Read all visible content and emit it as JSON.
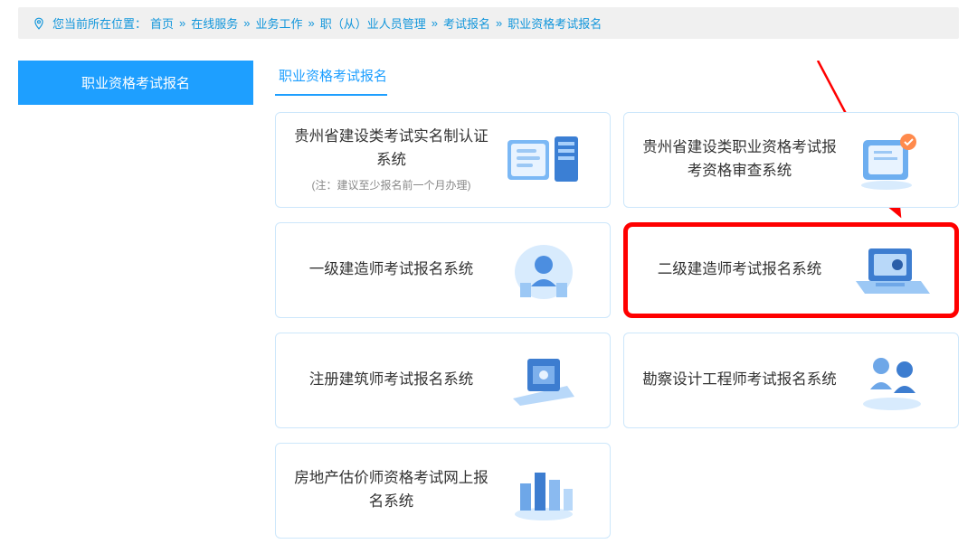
{
  "breadcrumb": {
    "label": "您当前所在位置：",
    "items": [
      "首页",
      "在线服务",
      "业务工作",
      "职（从）业人员管理",
      "考试报名",
      "职业资格考试报名"
    ],
    "sep": "»"
  },
  "sidebar": {
    "items": [
      {
        "label": "职业资格考试报名"
      }
    ]
  },
  "section": {
    "title": "职业资格考试报名"
  },
  "cards": [
    {
      "title": "贵州省建设类考试实名制认证系统",
      "note": "(注：建议至少报名前一个月办理)"
    },
    {
      "title": "贵州省建设类职业资格考试报考资格审查系统",
      "note": ""
    },
    {
      "title": "一级建造师考试报名系统",
      "note": ""
    },
    {
      "title": "二级建造师考试报名系统",
      "note": ""
    },
    {
      "title": "注册建筑师考试报名系统",
      "note": ""
    },
    {
      "title": "勘察设计工程师考试报名系统",
      "note": ""
    },
    {
      "title": "房地产估价师资格考试网上报名系统",
      "note": ""
    }
  ],
  "highlight_index": 3
}
